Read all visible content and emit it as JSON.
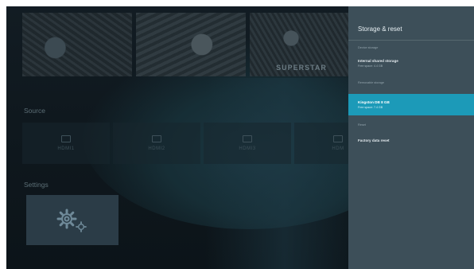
{
  "thumbnails": [
    {
      "caption": ""
    },
    {
      "caption": ""
    },
    {
      "caption": "SUPERSTAR"
    }
  ],
  "source_section": {
    "title": "Source",
    "tiles": [
      {
        "label": "HDMI1"
      },
      {
        "label": "HDMI2"
      },
      {
        "label": "HDMI3"
      },
      {
        "label": "HDM"
      }
    ]
  },
  "settings_section": {
    "title": "Settings",
    "tile_icon": "gear-icon"
  },
  "panel": {
    "title": "Storage & reset",
    "items": [
      {
        "type": "category",
        "label": "Device storage"
      },
      {
        "type": "item",
        "label": "Internal shared storage",
        "sub": "Free space: 4.4 GB"
      },
      {
        "type": "category",
        "label": "Removable storage"
      },
      {
        "type": "item",
        "label": "Kingston DB 8 GB",
        "sub": "Free space: 7.4 GB",
        "selected": true
      },
      {
        "type": "category",
        "label": "Reset"
      },
      {
        "type": "item",
        "label": "Factory data reset"
      }
    ],
    "accent_color": "#1c9ab8",
    "background_color": "#3d4f59"
  }
}
